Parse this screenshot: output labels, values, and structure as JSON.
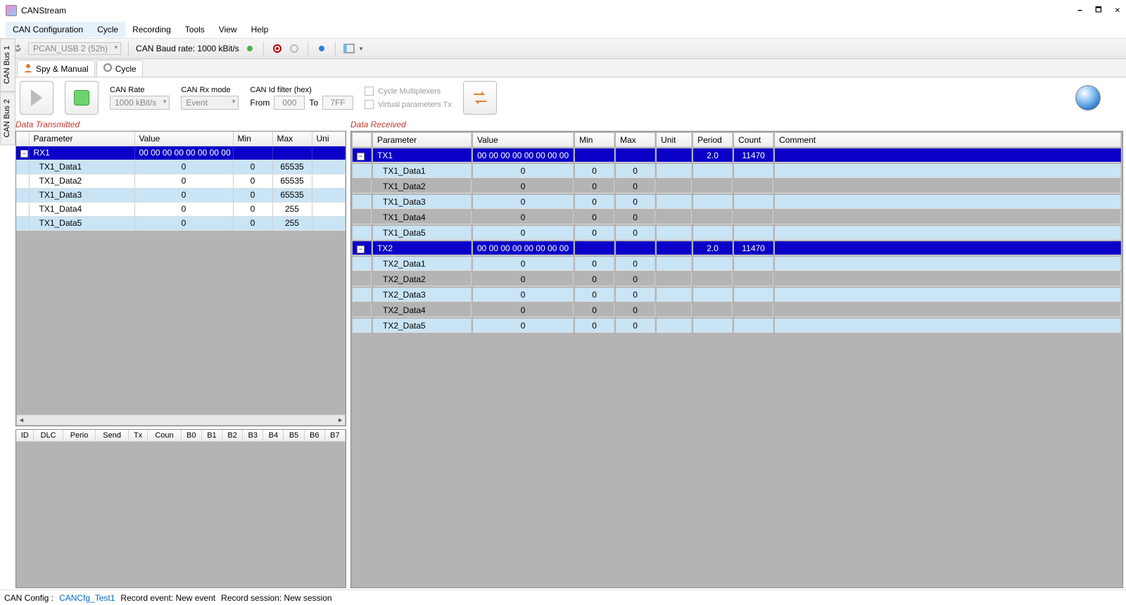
{
  "window": {
    "title": "CANStream"
  },
  "menu": {
    "items": [
      "CAN Configuration",
      "Cycle",
      "Recording",
      "Tools",
      "View",
      "Help"
    ],
    "highlighted": [
      0,
      1
    ]
  },
  "toolbar": {
    "device": "PCAN_USB 2 (52h)",
    "baud_label": "CAN Baud rate: 1000 kBit/s"
  },
  "tabs": {
    "spy": "Spy & Manual",
    "cycle": "Cycle"
  },
  "side_tabs": [
    "CAN Bus 1",
    "CAN Bus 2"
  ],
  "controls": {
    "rate_label": "CAN Rate",
    "rate_value": "1000 kBit/s",
    "rx_mode_label": "CAN Rx mode",
    "rx_mode_value": "Event",
    "id_filter_label": "CAN Id filter (hex)",
    "from_label": "From",
    "from_value": "000",
    "to_label": "To",
    "to_value": "7FF",
    "chk_multiplex": "Cycle Multiplexers",
    "chk_virtual": "Virtual parameters Tx"
  },
  "tx": {
    "title": "Data Transmitted",
    "columns": [
      "",
      "Parameter",
      "Value",
      "Min",
      "Max",
      "Uni"
    ],
    "groupRow": {
      "name": "RX1",
      "value": "00 00 00 00 00 00 00 00"
    },
    "rows": [
      {
        "name": "TX1_Data1",
        "value": "0",
        "min": "0",
        "max": "65535",
        "alt": true
      },
      {
        "name": "TX1_Data2",
        "value": "0",
        "min": "0",
        "max": "65535",
        "alt": false
      },
      {
        "name": "TX1_Data3",
        "value": "0",
        "min": "0",
        "max": "65535",
        "alt": true
      },
      {
        "name": "TX1_Data4",
        "value": "0",
        "min": "0",
        "max": "255",
        "alt": false
      },
      {
        "name": "TX1_Data5",
        "value": "0",
        "min": "0",
        "max": "255",
        "alt": true
      }
    ]
  },
  "rx": {
    "title": "Data Received",
    "columns": [
      "",
      "Parameter",
      "Value",
      "Min",
      "Max",
      "Unit",
      "Period",
      "Count",
      "Comment"
    ],
    "groups": [
      {
        "name": "TX1",
        "value": "00 00 00 00 00 00 00 00",
        "period": "2.0",
        "count": "11470",
        "rows": [
          {
            "name": "TX1_Data1",
            "value": "0",
            "min": "0",
            "max": "0",
            "alt": true
          },
          {
            "name": "TX1_Data2",
            "value": "0",
            "min": "0",
            "max": "0",
            "alt": false
          },
          {
            "name": "TX1_Data3",
            "value": "0",
            "min": "0",
            "max": "0",
            "alt": true
          },
          {
            "name": "TX1_Data4",
            "value": "0",
            "min": "0",
            "max": "0",
            "alt": false
          },
          {
            "name": "TX1_Data5",
            "value": "0",
            "min": "0",
            "max": "0",
            "alt": true
          }
        ]
      },
      {
        "name": "TX2",
        "value": "00 00 00 00 00 00 00 00",
        "period": "2.0",
        "count": "11470",
        "rows": [
          {
            "name": "TX2_Data1",
            "value": "0",
            "min": "0",
            "max": "0",
            "alt": true
          },
          {
            "name": "TX2_Data2",
            "value": "0",
            "min": "0",
            "max": "0",
            "alt": false
          },
          {
            "name": "TX2_Data3",
            "value": "0",
            "min": "0",
            "max": "0",
            "alt": true
          },
          {
            "name": "TX2_Data4",
            "value": "0",
            "min": "0",
            "max": "0",
            "alt": false
          },
          {
            "name": "TX2_Data5",
            "value": "0",
            "min": "0",
            "max": "0",
            "alt": true
          }
        ]
      }
    ]
  },
  "bottom_cols": [
    "ID",
    "DLC",
    "Perio",
    "Send",
    "Tx",
    "Coun",
    "B0",
    "B1",
    "B2",
    "B3",
    "B4",
    "B5",
    "B6",
    "B7"
  ],
  "status": {
    "config_label": "CAN Config :",
    "config_name": "CANCfg_Test1",
    "record_event": "Record event: New event",
    "record_session": "Record session: New session"
  }
}
